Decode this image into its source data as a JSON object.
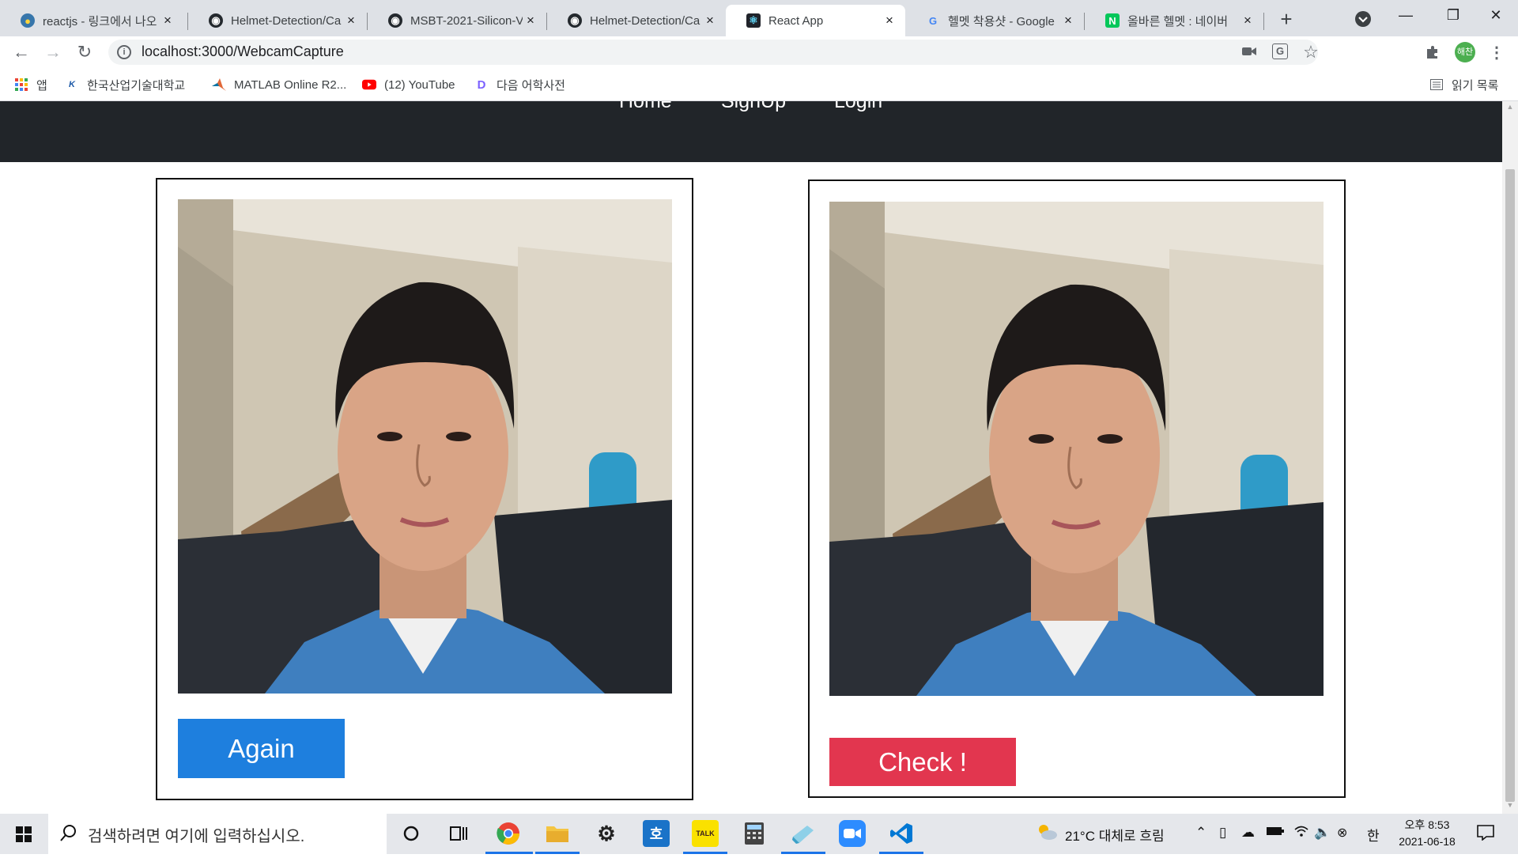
{
  "browser": {
    "tabs": [
      {
        "label": "reactjs - 링크에서 나오"
      },
      {
        "label": "Helmet-Detection/Ca"
      },
      {
        "label": "MSBT-2021-Silicon-V"
      },
      {
        "label": "Helmet-Detection/Ca"
      },
      {
        "label": "React App"
      },
      {
        "label": "헬멧 착용샷 - Google"
      },
      {
        "label": "올바른 헬멧 : 네이버"
      }
    ],
    "url": "localhost:3000/WebcamCapture",
    "profile_initials": "해찬",
    "bookmarks": [
      {
        "label": "앱"
      },
      {
        "label": "한국산업기술대학교"
      },
      {
        "label": "MATLAB Online R2..."
      },
      {
        "label": "(12) YouTube"
      },
      {
        "label": "다음 어학사전"
      }
    ],
    "reading_list": "읽기 목록"
  },
  "page": {
    "nav": [
      "Home",
      "SignUp",
      "Login"
    ],
    "again_button": "Again",
    "check_button": "Check !"
  },
  "taskbar": {
    "search_placeholder": "검색하려면 여기에 입력하십시오.",
    "weather": "21°C  대체로 흐림",
    "ime": "한",
    "time": "오후 8:53",
    "date": "2021-06-18"
  },
  "colors": {
    "navbar": "#212529",
    "again": "#1e7fde",
    "check": "#e2364f",
    "chrome_tabstrip": "#dee1e6"
  }
}
